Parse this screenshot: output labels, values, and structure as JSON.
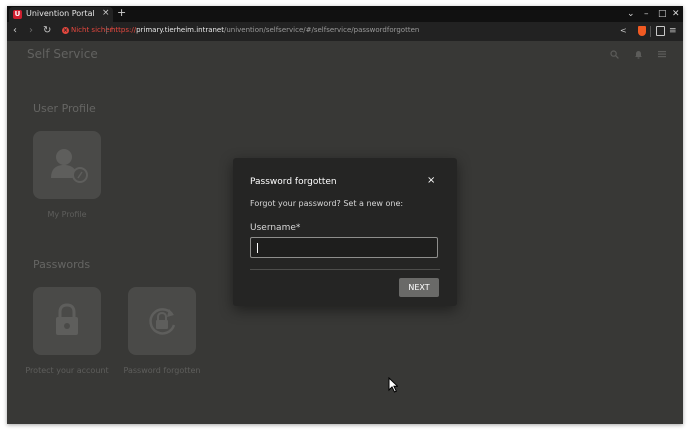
{
  "browser": {
    "tab": {
      "title": "Univention Portal",
      "favicon_letter": "U",
      "close_glyph": "×"
    },
    "new_tab_glyph": "+",
    "window_controls": {
      "dropdown": "⌄",
      "minimize": "–",
      "maximize": "□",
      "close": "✕"
    },
    "nav": {
      "back": "‹",
      "forward": "›",
      "reload": "↻"
    },
    "security_label": "Nicht sicher",
    "url": {
      "scheme": "https://",
      "host": "primary.tierheim.intranet",
      "path": "/univention/selfservice/#/selfservice/passwordforgotten"
    },
    "icons": [
      "share-icon",
      "brave-shield-icon",
      "sidebar-icon",
      "menu-icon"
    ],
    "colors": {
      "insecure": "#e4473e",
      "brave": "#f15a22"
    }
  },
  "portal": {
    "title": "Self Service",
    "header_icons": [
      "search-icon",
      "bell-icon",
      "menu-icon"
    ],
    "sections": [
      {
        "title": "User Profile",
        "tiles": [
          {
            "label": "My Profile",
            "icon": "user-profile-icon"
          }
        ]
      },
      {
        "title": "Passwords",
        "tiles": [
          {
            "label": "Protect your account",
            "icon": "lock-icon"
          },
          {
            "label": "Password forgotten",
            "icon": "password-reset-icon"
          }
        ]
      }
    ]
  },
  "modal": {
    "title": "Password forgotten",
    "close_glyph": "×",
    "description": "Forgot your password? Set a new one:",
    "field_label": "Username*",
    "username_value": "",
    "next_label": "NEXT"
  }
}
